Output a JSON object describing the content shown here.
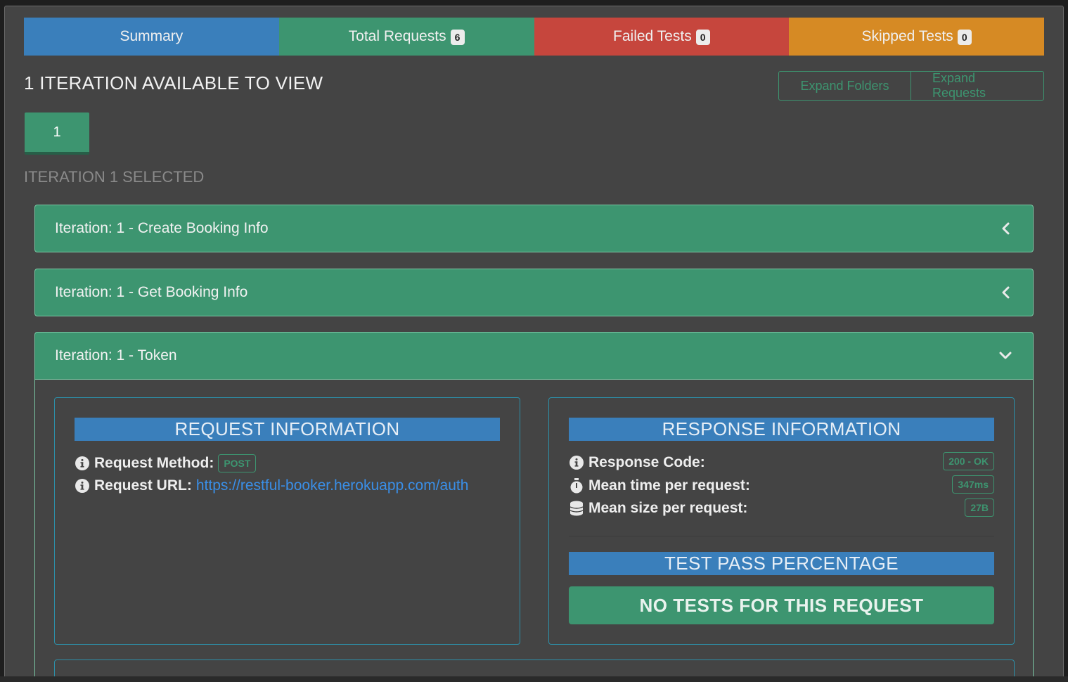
{
  "tabs": {
    "summary": "Summary",
    "total_label": "Total Requests",
    "total_count": "6",
    "failed_label": "Failed Tests",
    "failed_count": "0",
    "skipped_label": "Skipped Tests",
    "skipped_count": "0"
  },
  "iterations": {
    "title": "1 ITERATION AVAILABLE TO VIEW",
    "expand_folders": "Expand Folders",
    "expand_requests": "Expand Requests",
    "buttons": [
      "1"
    ],
    "selected_text": "ITERATION 1 SELECTED"
  },
  "requests": [
    {
      "title": "Iteration: 1 - Create Booking Info",
      "expanded": false,
      "icon": "chevron-left-icon"
    },
    {
      "title": "Iteration: 1 - Get Booking Info",
      "expanded": false,
      "icon": "chevron-left-icon"
    },
    {
      "title": "Iteration: 1 - Token",
      "expanded": true,
      "icon": "chevron-down-icon"
    }
  ],
  "request_info": {
    "heading": "REQUEST INFORMATION",
    "method_label": "Request Method:",
    "method_value": "POST",
    "url_label": "Request URL:",
    "url_value": "https://restful-booker.herokuapp.com/auth"
  },
  "response_info": {
    "heading": "RESPONSE INFORMATION",
    "code_label": "Response Code:",
    "code_value": "200 - OK",
    "time_label": "Mean time per request:",
    "time_value": "347ms",
    "size_label": "Mean size per request:",
    "size_value": "27B"
  },
  "test_pass": {
    "heading": "TEST PASS PERCENTAGE",
    "message": "NO TESTS FOR THIS REQUEST"
  },
  "colors": {
    "summary": "#3a7fbb",
    "success": "#3d9570",
    "danger": "#c6463d",
    "warning": "#d68a24",
    "background": "#444444",
    "link": "#3a8fe8"
  }
}
